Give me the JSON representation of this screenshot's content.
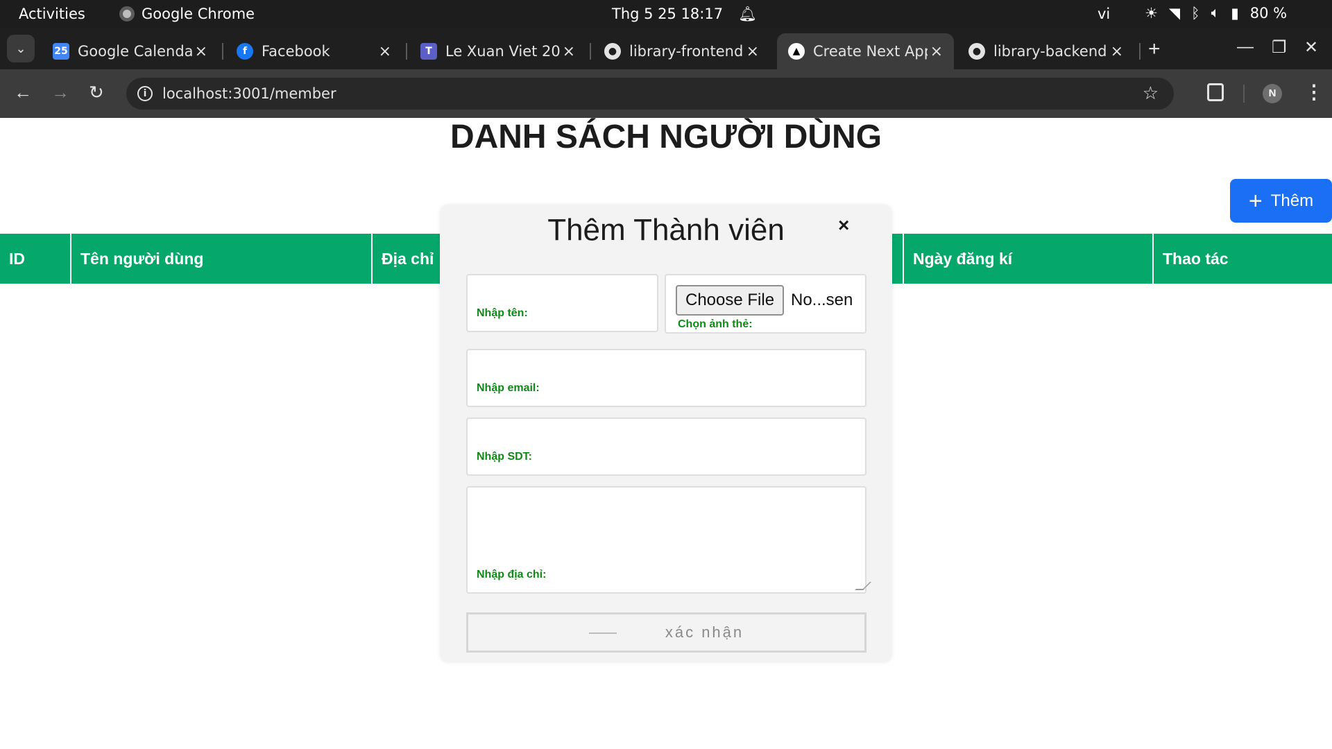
{
  "os_bar": {
    "activities": "Activities",
    "app_name": "Google Chrome",
    "clock": "Thg 5 25  18:17",
    "language": "vi",
    "battery": "80 %"
  },
  "tabs": [
    {
      "title": "Google Calendar",
      "favicon": "calendar-icon",
      "favicon_color": "#4285f4"
    },
    {
      "title": "Facebook",
      "favicon": "facebook-icon",
      "favicon_color": "#1877f2"
    },
    {
      "title": "Le Xuan Viet 20",
      "favicon": "teams-icon",
      "favicon_color": "#5b5fc7"
    },
    {
      "title": "library-frontend",
      "favicon": "github-icon",
      "favicon_color": "#2b2b2b"
    },
    {
      "title": "Create Next App",
      "favicon": "nextjs-icon",
      "favicon_color": "#000000",
      "active": true
    },
    {
      "title": "library-backend",
      "favicon": "github-icon",
      "favicon_color": "#2b2b2b"
    }
  ],
  "address_bar": {
    "url": "localhost:3001/member",
    "profile_initial": "N"
  },
  "page": {
    "title": "DANH SÁCH NGƯỜI DÙNG",
    "add_button_label": "Thêm",
    "accent_color": "#05a86a",
    "button_color": "#1a6ff5"
  },
  "table": {
    "columns": [
      "ID",
      "Tên người dùng",
      "Địa chỉ",
      "Ngày đăng kí",
      "Thao tác"
    ]
  },
  "modal": {
    "title": "Thêm Thành viên",
    "close_symbol": "×",
    "name_label": "Nhập tên:",
    "file_button": "Choose File",
    "file_status": "No...sen",
    "file_label": "Chọn ảnh thẻ:",
    "email_label": "Nhập email:",
    "phone_label": "Nhập SDT:",
    "address_label": "Nhập địa chỉ:",
    "submit_label": "xác nhận"
  }
}
